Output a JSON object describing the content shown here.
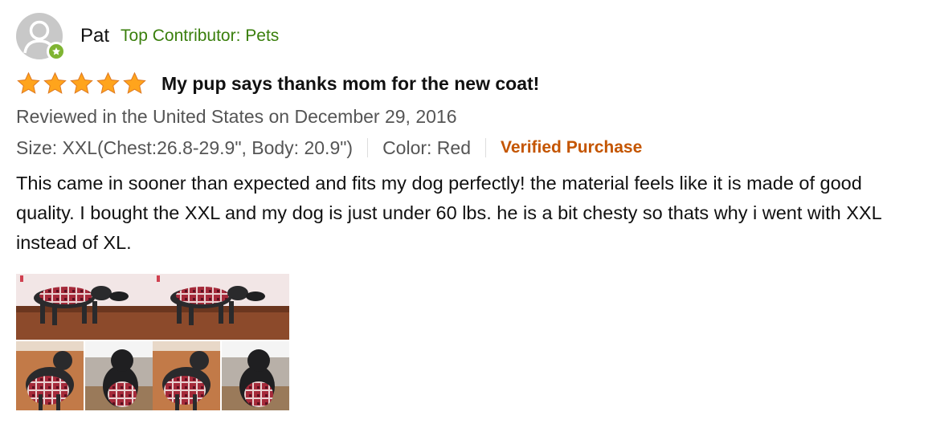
{
  "reviewer": {
    "name": "Pat",
    "badge": "Top Contributor: Pets",
    "avatar_icon": "default-profile-icon",
    "badge_icon": "star-badge-icon",
    "badge_color": "#7fb432"
  },
  "review": {
    "rating": 5,
    "rating_max": 5,
    "star_color": "#ffa41c",
    "title": "My pup says thanks mom for the new coat!",
    "date": "Reviewed in the United States on December 29, 2016",
    "size": "Size: XXL(Chest:26.8-29.9\", Body: 20.9\")",
    "color": "Color: Red",
    "verified": "Verified Purchase",
    "body": "This came in sooner than expected and fits my dog perfectly! the material feels like it is made of good quality. I bought the XXL and my dog is just under 60 lbs. he is a bit chesty so thats why i went with XXL instead of XL."
  },
  "images": {
    "count": 2,
    "description_icon": "dog-photo-collage"
  }
}
